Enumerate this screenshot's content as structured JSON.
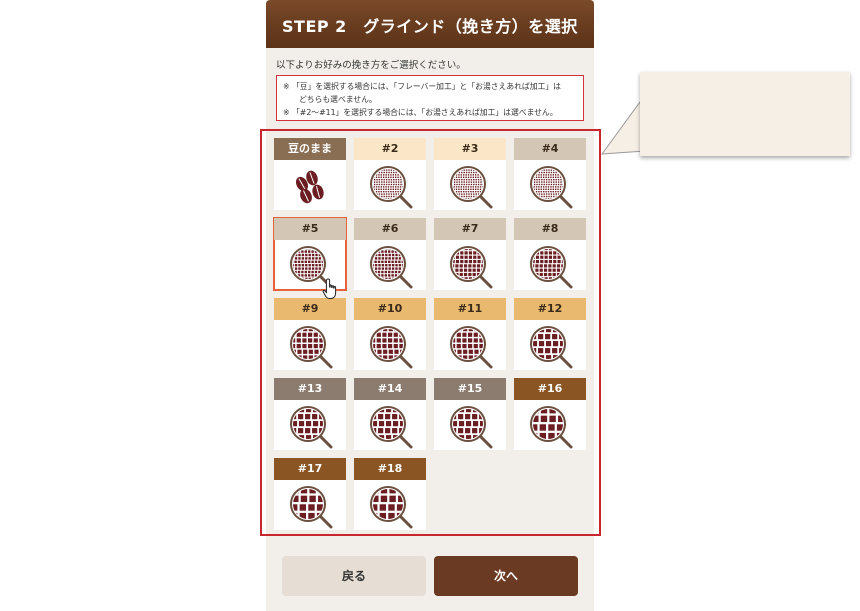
{
  "header": {
    "title": "STEP 2　グラインド（挽き方）を選択"
  },
  "intro": "以下よりお好みの挽き方をご選択ください。",
  "notice": {
    "line1": "※ 「豆」を選択する場合には、「フレーバー加工」と「お湯さえあれば加工」は",
    "line2": "どちらも選べません。",
    "line3": "※ 「#2〜#11」を選択する場合には、「お湯さえあれば加工」は選べません。"
  },
  "grind_options": [
    {
      "label": "豆のまま",
      "header_color": "#8a6e54",
      "text_color": "#ffffff",
      "icon": "coffee-beans-icon"
    },
    {
      "label": "#2",
      "header_color": "#fbe6c8",
      "text_color": "#3a2a1a",
      "icon": "grind-fine-icon"
    },
    {
      "label": "#3",
      "header_color": "#fbe6c8",
      "text_color": "#3a2a1a",
      "icon": "grind-fine-icon"
    },
    {
      "label": "#4",
      "header_color": "#d3c6b5",
      "text_color": "#3a2a1a",
      "icon": "grind-fine-icon"
    },
    {
      "label": "#5",
      "header_color": "#d3c6b5",
      "text_color": "#3a2a1a",
      "icon": "grind-medium-fine-icon"
    },
    {
      "label": "#6",
      "header_color": "#d3c6b5",
      "text_color": "#3a2a1a",
      "icon": "grind-medium-fine-icon"
    },
    {
      "label": "#7",
      "header_color": "#d3c6b5",
      "text_color": "#3a2a1a",
      "icon": "grind-medium-icon"
    },
    {
      "label": "#8",
      "header_color": "#d3c6b5",
      "text_color": "#3a2a1a",
      "icon": "grind-medium-icon"
    },
    {
      "label": "#9",
      "header_color": "#e8b96e",
      "text_color": "#3a2a1a",
      "icon": "grind-medium-coarse-icon"
    },
    {
      "label": "#10",
      "header_color": "#e8b96e",
      "text_color": "#3a2a1a",
      "icon": "grind-medium-coarse-icon"
    },
    {
      "label": "#11",
      "header_color": "#e8b96e",
      "text_color": "#3a2a1a",
      "icon": "grind-medium-coarse-icon"
    },
    {
      "label": "#12",
      "header_color": "#e8b96e",
      "text_color": "#3a2a1a",
      "icon": "grind-coarse-icon"
    },
    {
      "label": "#13",
      "header_color": "#8c7c70",
      "text_color": "#ffffff",
      "icon": "grind-coarse-icon"
    },
    {
      "label": "#14",
      "header_color": "#8c7c70",
      "text_color": "#ffffff",
      "icon": "grind-coarse-icon"
    },
    {
      "label": "#15",
      "header_color": "#8c7c70",
      "text_color": "#ffffff",
      "icon": "grind-coarse-icon"
    },
    {
      "label": "#16",
      "header_color": "#8a5523",
      "text_color": "#ffffff",
      "icon": "grind-very-coarse-icon"
    },
    {
      "label": "#17",
      "header_color": "#8a5523",
      "text_color": "#ffffff",
      "icon": "grind-very-coarse-icon"
    },
    {
      "label": "#18",
      "header_color": "#8a5523",
      "text_color": "#ffffff",
      "icon": "grind-very-coarse-icon"
    }
  ],
  "selected_index": 4,
  "buttons": {
    "back": "戻る",
    "next": "次へ"
  },
  "colors": {
    "header_brown": "#6a3d20",
    "frame_red": "#c9272f",
    "selection_orange": "#e8623e",
    "next_button": "#6b3a22",
    "back_button": "#e6ddd4"
  }
}
